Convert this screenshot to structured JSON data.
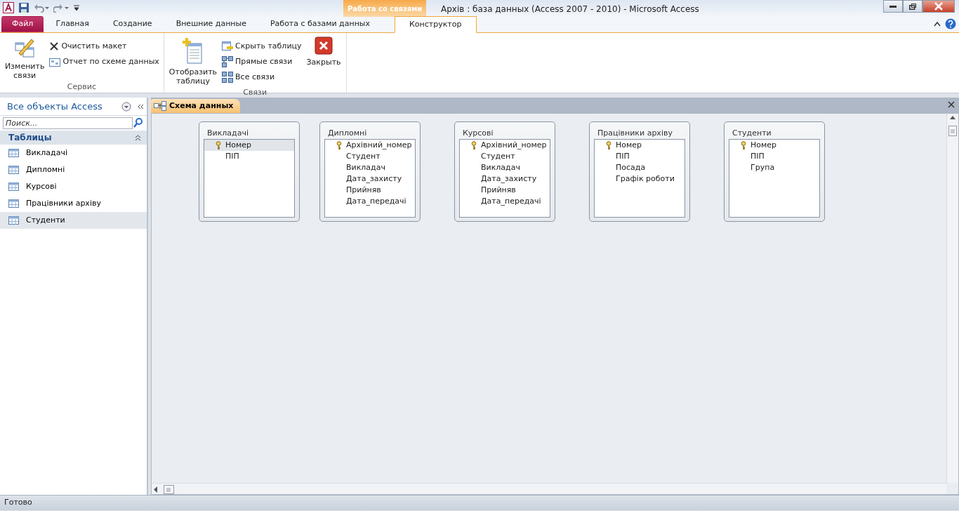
{
  "window": {
    "title": "Архів : база данных (Access 2007 - 2010)  -  Microsoft Access",
    "context_tab_group": "Работа со связями"
  },
  "ribbon_tabs": [
    {
      "label": "Файл",
      "kind": "file",
      "selected": false
    },
    {
      "label": "Главная",
      "kind": "tab",
      "selected": false
    },
    {
      "label": "Создание",
      "kind": "tab",
      "selected": false
    },
    {
      "label": "Внешние данные",
      "kind": "tab",
      "selected": false
    },
    {
      "label": "Работа с базами данных",
      "kind": "tab",
      "selected": false
    },
    {
      "label": "Конструктор",
      "kind": "context",
      "selected": true
    }
  ],
  "ribbon_groups": [
    {
      "label": "Сервис",
      "buttons": [
        {
          "label": "Изменить связи",
          "kind": "large"
        },
        {
          "label": "Очистить макет",
          "kind": "small"
        },
        {
          "label": "Отчет по схеме данных",
          "kind": "small"
        }
      ]
    },
    {
      "label": "Связи",
      "buttons": [
        {
          "label": "Отобразить таблицу",
          "kind": "large"
        },
        {
          "label": "Скрыть таблицу",
          "kind": "small"
        },
        {
          "label": "Прямые связи",
          "kind": "small"
        },
        {
          "label": "Все связи",
          "kind": "small"
        },
        {
          "label": "Закрыть",
          "kind": "large"
        }
      ]
    }
  ],
  "navigation": {
    "title": "Все объекты Access",
    "search": {
      "placeholder": "Поиск..."
    },
    "section": "Таблицы",
    "items": [
      {
        "label": "Викладачі",
        "selected": false
      },
      {
        "label": "Дипломні",
        "selected": false
      },
      {
        "label": "Курсові",
        "selected": false
      },
      {
        "label": "Працівники архіву",
        "selected": false
      },
      {
        "label": "Студенти",
        "selected": true
      }
    ]
  },
  "document_tab": {
    "label": "Схема данных"
  },
  "tables": [
    {
      "title": "Викладачі",
      "fields": [
        {
          "name": "Номер",
          "key": true,
          "selected": true
        },
        {
          "name": "ПІП",
          "key": false,
          "selected": false
        }
      ]
    },
    {
      "title": "Дипломні",
      "fields": [
        {
          "name": "Архівний_номер",
          "key": true,
          "selected": false
        },
        {
          "name": "Студент",
          "key": false,
          "selected": false
        },
        {
          "name": "Викладач",
          "key": false,
          "selected": false
        },
        {
          "name": "Дата_захисту",
          "key": false,
          "selected": false
        },
        {
          "name": "Прийняв",
          "key": false,
          "selected": false
        },
        {
          "name": "Дата_передачі",
          "key": false,
          "selected": false
        }
      ]
    },
    {
      "title": "Курсові",
      "fields": [
        {
          "name": "Архівний_номер",
          "key": true,
          "selected": false
        },
        {
          "name": "Студент",
          "key": false,
          "selected": false
        },
        {
          "name": "Викладач",
          "key": false,
          "selected": false
        },
        {
          "name": "Дата_захисту",
          "key": false,
          "selected": false
        },
        {
          "name": "Прийняв",
          "key": false,
          "selected": false
        },
        {
          "name": "Дата_передачі",
          "key": false,
          "selected": false
        }
      ]
    },
    {
      "title": "Працівники архіву",
      "fields": [
        {
          "name": "Номер",
          "key": true,
          "selected": false
        },
        {
          "name": "ПІП",
          "key": false,
          "selected": false
        },
        {
          "name": "Посада",
          "key": false,
          "selected": false
        },
        {
          "name": "Графік роботи",
          "key": false,
          "selected": false
        }
      ]
    },
    {
      "title": "Студенти",
      "fields": [
        {
          "name": "Номер",
          "key": true,
          "selected": false
        },
        {
          "name": "ПІП",
          "key": false,
          "selected": false
        },
        {
          "name": "Група",
          "key": false,
          "selected": false
        }
      ]
    }
  ],
  "status_bar": {
    "text": "Готово"
  }
}
